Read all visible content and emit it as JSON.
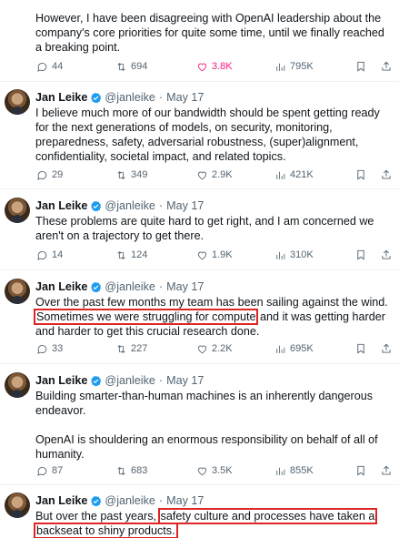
{
  "thread": {
    "top_text": "However, I have been disagreeing with OpenAI leadership about the company's core priorities for quite some time, until we finally reached a breaking point.",
    "top_stats": {
      "replies": "44",
      "reposts": "694",
      "likes": "3.8K",
      "views": "795K"
    },
    "tweets": [
      {
        "name": "Jan Leike",
        "handle": "@janleike",
        "date": "May 17",
        "text": "I believe much more of our bandwidth should be spent getting ready for the next generations of models, on security, monitoring, preparedness, safety, adversarial robustness, (super)alignment, confidentiality, societal impact, and related topics.",
        "replies": "29",
        "reposts": "349",
        "likes": "2.9K",
        "views": "421K"
      },
      {
        "name": "Jan Leike",
        "handle": "@janleike",
        "date": "May 17",
        "text": "These problems are quite hard to get right, and I am concerned we aren't on a trajectory to get there.",
        "replies": "14",
        "reposts": "124",
        "likes": "1.9K",
        "views": "310K"
      },
      {
        "name": "Jan Leike",
        "handle": "@janleike",
        "date": "May 17",
        "text_pre": "Over the past few months my team has been sailing against the wind. ",
        "text_hl": "Sometimes we were struggling for compute",
        "text_post": " and it was getting harder and harder to get this crucial research done.",
        "replies": "33",
        "reposts": "227",
        "likes": "2.2K",
        "views": "695K"
      },
      {
        "name": "Jan Leike",
        "handle": "@janleike",
        "date": "May 17",
        "text_p1": "Building smarter-than-human machines is an inherently dangerous endeavor.",
        "text_p2": "OpenAI is shouldering an enormous responsibility on behalf of all of humanity.",
        "replies": "87",
        "reposts": "683",
        "likes": "3.5K",
        "views": "855K"
      },
      {
        "name": "Jan Leike",
        "handle": "@janleike",
        "date": "May 17",
        "text_pre": "But over the past years, ",
        "text_hl1": "safety culture and processes have taken a",
        "text_hl2": "backseat to shiny products."
      }
    ]
  },
  "colors": {
    "text": "#0f1419",
    "muted": "#536471",
    "like": "#f91880",
    "verified": "#1d9bf0",
    "highlight_box": "#e02424"
  },
  "icons": [
    "reply-icon",
    "repost-icon",
    "like-icon",
    "views-icon",
    "bookmark-icon",
    "share-icon",
    "verified-badge-icon"
  ]
}
